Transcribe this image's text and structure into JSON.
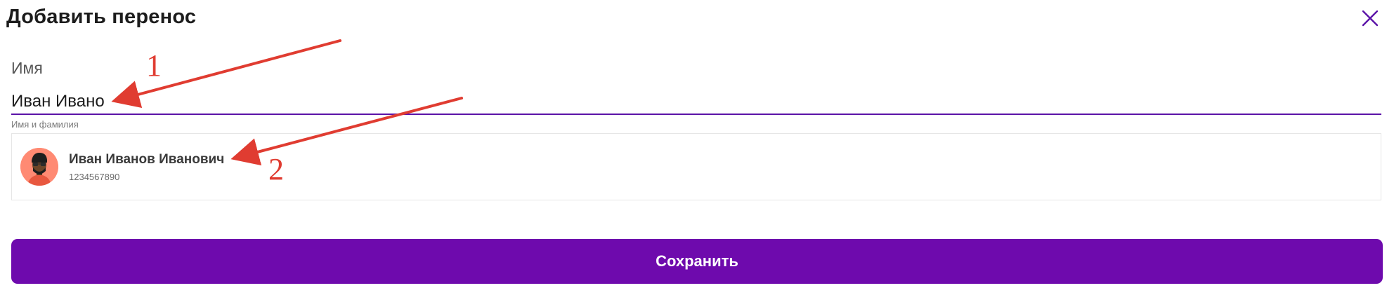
{
  "dialog": {
    "title": "Добавить перенос",
    "close_icon": "close-icon"
  },
  "form": {
    "name_label": "Имя",
    "name_value": "Иван Ивано",
    "name_hint": "Имя и фамилия"
  },
  "suggestions": [
    {
      "name": "Иван Иванов Иванович",
      "phone": "1234567890",
      "avatar_icon": "user-avatar"
    }
  ],
  "annotations": {
    "marker_1": "1",
    "marker_2": "2",
    "color": "#e03c31"
  },
  "actions": {
    "save_label": "Сохранить"
  },
  "colors": {
    "accent": "#6e0aad",
    "input_underline": "#5b13a8",
    "avatar_bg": "#ff8a73"
  }
}
